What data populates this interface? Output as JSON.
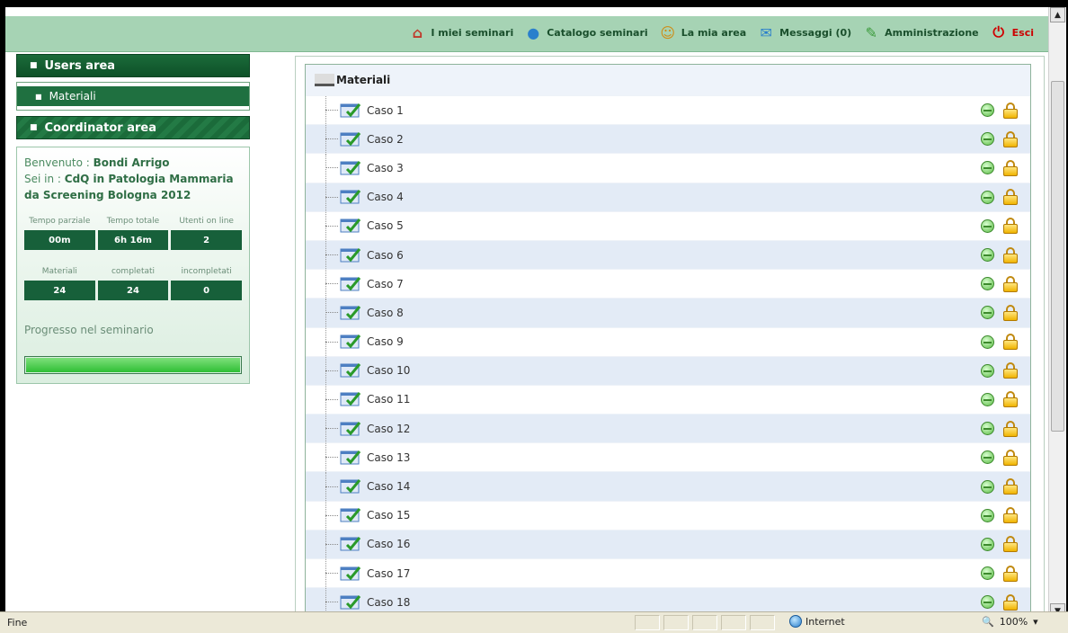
{
  "nav": {
    "items": [
      {
        "label": "I miei seminari",
        "icon": "home-icon"
      },
      {
        "label": "Catalogo seminari",
        "icon": "catalog-drop-icon"
      },
      {
        "label": "La mia area",
        "icon": "user-icon"
      },
      {
        "label": "Messaggi (0)",
        "icon": "messages-icon"
      },
      {
        "label": "Amministrazione",
        "icon": "admin-user-icon"
      },
      {
        "label": "Esci",
        "icon": "exit-icon"
      }
    ]
  },
  "sidebar": {
    "users_area": "Users area",
    "materiali": "Materiali",
    "coordinator_area": "Coordinator area",
    "welcome_label": "Benvenuto :",
    "user_name": "Bondi Arrigo",
    "where_label": "Sei in :",
    "course": "CdQ in Patologia Mammaria da Screening Bologna 2012",
    "stats1": [
      {
        "label": "Tempo parziale",
        "value": "00m"
      },
      {
        "label": "Tempo totale",
        "value": "6h 16m"
      },
      {
        "label": "Utenti on line",
        "value": "2"
      }
    ],
    "stats2": [
      {
        "label": "Materiali",
        "value": "24"
      },
      {
        "label": "completati",
        "value": "24"
      },
      {
        "label": "incompletati",
        "value": "0"
      }
    ],
    "progress_label": "Progresso nel seminario",
    "progress": 1.0
  },
  "tree": {
    "root": "Materiali",
    "items": [
      "Caso 1",
      "Caso 2",
      "Caso 3",
      "Caso 4",
      "Caso 5",
      "Caso 6",
      "Caso 7",
      "Caso 8",
      "Caso 9",
      "Caso 10",
      "Caso 11",
      "Caso 12",
      "Caso 13",
      "Caso 14",
      "Caso 15",
      "Caso 16",
      "Caso 17",
      "Caso 18"
    ]
  },
  "statusbar": {
    "text": "Fine",
    "zone": "Internet",
    "zoom": "100%"
  },
  "colors": {
    "accent": "#1b6b3a",
    "nav_bg": "#a6d3b4",
    "row_alt": "#e3ebf6"
  }
}
